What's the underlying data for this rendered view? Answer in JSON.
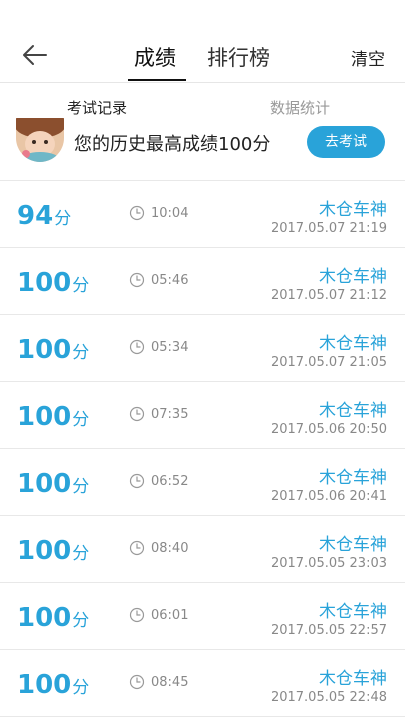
{
  "header": {
    "back_icon": "arrow-left-icon",
    "tabs": [
      "成绩",
      "排行榜"
    ],
    "clear_label": "清空"
  },
  "subtabs": [
    "考试记录",
    "数据统计"
  ],
  "best": {
    "text": "您的历史最高成绩100分",
    "button_label": "去考试",
    "accent_color": "#29a3d9"
  },
  "records": [
    {
      "score": "94",
      "unit": "分",
      "duration": "10:04",
      "name": "木仓车神",
      "datetime": "2017.05.07  21:19"
    },
    {
      "score": "100",
      "unit": "分",
      "duration": "05:46",
      "name": "木仓车神",
      "datetime": "2017.05.07  21:12"
    },
    {
      "score": "100",
      "unit": "分",
      "duration": "05:34",
      "name": "木仓车神",
      "datetime": "2017.05.07  21:05"
    },
    {
      "score": "100",
      "unit": "分",
      "duration": "07:35",
      "name": "木仓车神",
      "datetime": "2017.05.06  20:50"
    },
    {
      "score": "100",
      "unit": "分",
      "duration": "06:52",
      "name": "木仓车神",
      "datetime": "2017.05.06  20:41"
    },
    {
      "score": "100",
      "unit": "分",
      "duration": "08:40",
      "name": "木仓车神",
      "datetime": "2017.05.05  23:03"
    },
    {
      "score": "100",
      "unit": "分",
      "duration": "06:01",
      "name": "木仓车神",
      "datetime": "2017.05.05  22:57"
    },
    {
      "score": "100",
      "unit": "分",
      "duration": "08:45",
      "name": "木仓车神",
      "datetime": "2017.05.05  22:48"
    }
  ]
}
